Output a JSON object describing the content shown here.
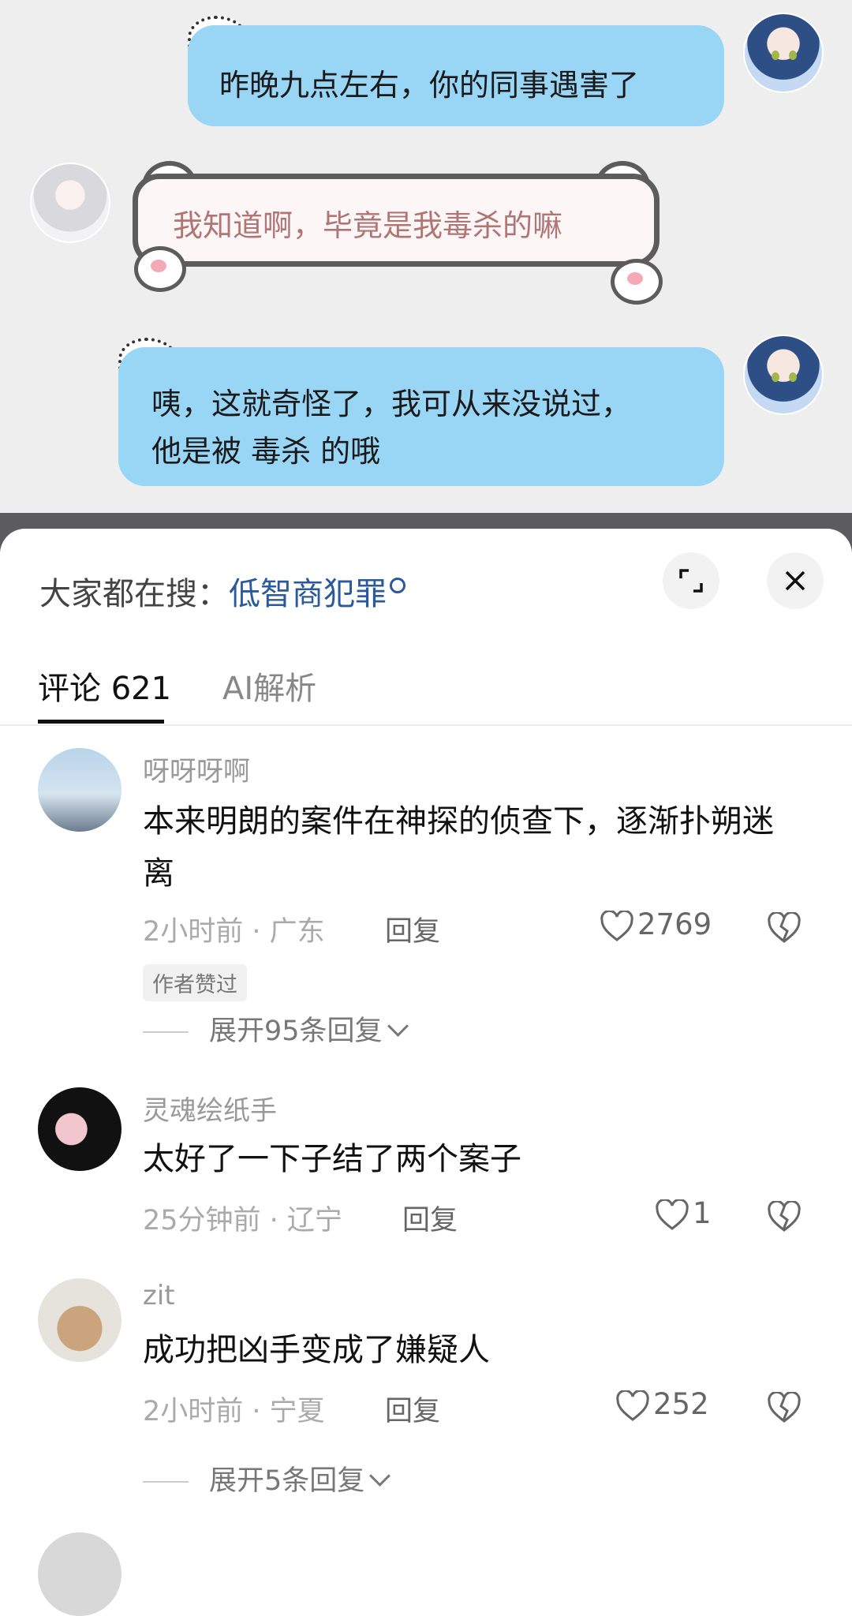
{
  "chat": {
    "messages": [
      {
        "side": "right",
        "text": "昨晚九点左右，你的同事遇害了"
      },
      {
        "side": "left",
        "text": "我知道啊，毕竟是我毒杀的嘛"
      },
      {
        "side": "right",
        "line1": "咦，这就奇怪了，我可从来没说过，",
        "line2": "他是被 毒杀 的哦"
      }
    ]
  },
  "sheet": {
    "trending_prefix": "大家都在搜：",
    "trending_keyword": "低智商犯罪",
    "expand_icon": "expand-icon",
    "close_icon": "close-icon",
    "tabs": [
      {
        "label": "评论 621",
        "active": true
      },
      {
        "label": "AI解析",
        "active": false
      }
    ]
  },
  "comments": [
    {
      "user": "呀呀呀啊",
      "text": "本来明朗的案件在神探的侦查下，逐渐扑朔迷离",
      "time": "2小时前 · 广东",
      "reply": "回复",
      "likes": "2769",
      "badge": "作者赞过",
      "expand": "展开95条回复"
    },
    {
      "user": "灵魂绘纸手",
      "text": "太好了一下子结了两个案子",
      "time": "25分钟前 · 辽宁",
      "reply": "回复",
      "likes": "1"
    },
    {
      "user": "zit",
      "text": "成功把凶手变成了嫌疑人",
      "time": "2小时前 · 宁夏",
      "reply": "回复",
      "likes": "252",
      "expand": "展开5条回复"
    }
  ]
}
